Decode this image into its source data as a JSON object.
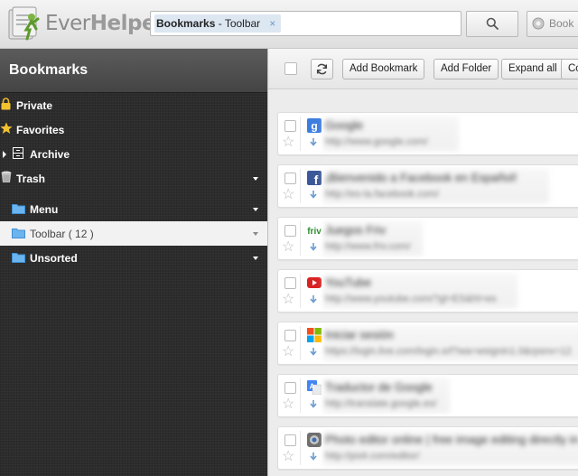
{
  "app": {
    "logo_part1": "Ever",
    "logo_part2": "Helper"
  },
  "search": {
    "tag_strong": "Bookmarks",
    "tag_rest": " - Toolbar",
    "tag_close": "×"
  },
  "header_buttons": {
    "bookmarks_label": "Book"
  },
  "sidebar": {
    "title": "Bookmarks",
    "items": [
      {
        "label": "Private",
        "icon": "lock-icon"
      },
      {
        "label": "Favorites",
        "icon": "star-icon"
      },
      {
        "label": "Archive",
        "icon": "archive-icon"
      },
      {
        "label": "Trash",
        "icon": "trash-icon"
      },
      {
        "label": "Menu",
        "icon": "folder-icon"
      },
      {
        "label": "Toolbar ( 12 )",
        "icon": "folder-icon"
      },
      {
        "label": "Unsorted",
        "icon": "folder-icon"
      }
    ]
  },
  "toolbar": {
    "add_bookmark": "Add Bookmark",
    "add_folder": "Add Folder",
    "expand_all": "Expand all",
    "collapse_all": "Co"
  },
  "bookmarks": [
    {
      "title": "Google",
      "url": "http://www.google.com/",
      "icon": "google-icon"
    },
    {
      "title": "¡Bienvenido a Facebook en Español!",
      "url": "http://es-la.facebook.com/",
      "icon": "facebook-icon"
    },
    {
      "title": "Juegos Friv",
      "url": "http://www.friv.com/",
      "icon": "friv-icon"
    },
    {
      "title": "YouTube",
      "url": "http://www.youtube.com/?gl=ES&hl=es",
      "icon": "youtube-icon"
    },
    {
      "title": "Iniciar sesión",
      "url": "https://login.live.com/login.srf?wa=wsignin1.0&rpsnv=12",
      "icon": "microsoft-icon"
    },
    {
      "title": "Traductor de Google",
      "url": "http://translate.google.es/",
      "icon": "translate-icon"
    },
    {
      "title": "Photo editor online | free image editing directly in your browser",
      "url": "http://pixlr.com/editor/",
      "icon": "pixlr-icon"
    }
  ],
  "colors": {
    "accent": "#4a90d9",
    "sidebar_bg": "#2d2d2d",
    "folder_blue": "#6cb4ee"
  }
}
